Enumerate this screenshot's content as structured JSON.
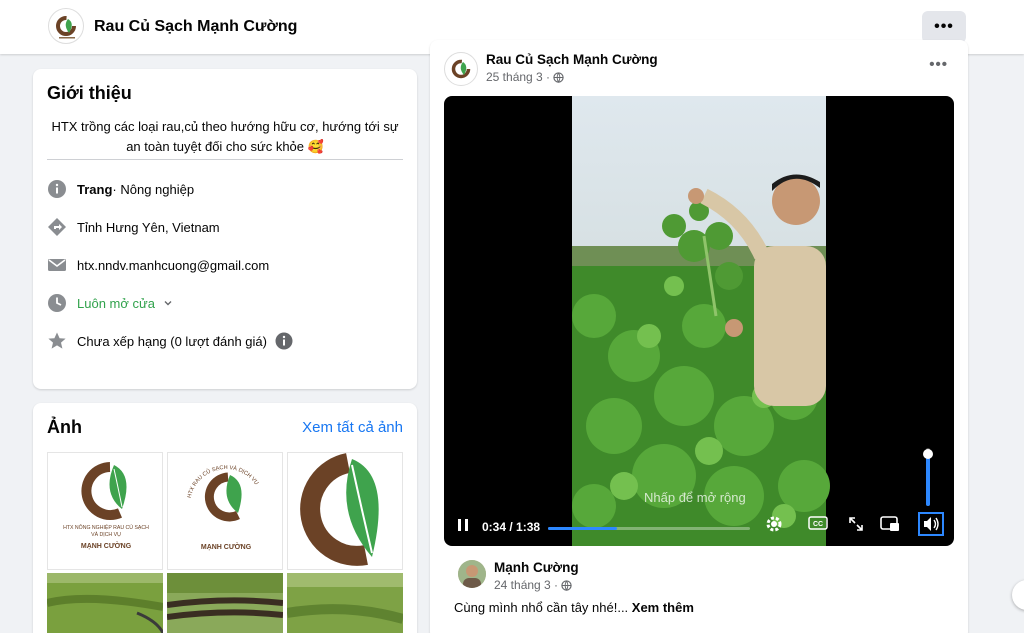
{
  "page": {
    "name": "Rau Củ Sạch Mạnh Cường",
    "more_label": "•••"
  },
  "intro": {
    "heading": "Giới thiệu",
    "bio": "HTX trồng các loại rau,củ theo hướng hữu cơ, hướng tới sự an toàn tuyệt đối cho sức khỏe 🥰",
    "category_label": "Trang",
    "category": " · Nông nghiệp",
    "location": "Tỉnh Hưng Yên, Vietnam",
    "email": "htx.nndv.manhcuong@gmail.com",
    "hours": "Luôn mở cửa",
    "rating": "Chưa xếp hạng (0 lượt đánh giá)"
  },
  "photos": {
    "heading": "Ảnh",
    "see_all": "Xem tất cả ảnh",
    "logo1_line1": "HTX NÔNG NGHIỆP RAU CỦ SẠCH",
    "logo1_line2": "VÀ DỊCH VỤ",
    "logo_brand": "MẠNH CƯỜNG",
    "logo2_arc": "HTX RAU CỦ SẠCH VÀ DỊCH VỤ"
  },
  "post": {
    "author": "Rau Củ Sạch Mạnh Cường",
    "date": "25 tháng 3 · ",
    "more": "•••",
    "video": {
      "hint": "Nhấp để mở rộng",
      "time": "0:34 / 1:38",
      "progress_fraction": 0.34,
      "volume_fraction": 0.9
    },
    "shared": {
      "author": "Mạnh Cường",
      "date": "24 tháng 3 · ",
      "caption": "Cùng mình nhổ cần tây nhé!... ",
      "see_more": "Xem thêm"
    }
  },
  "colors": {
    "accent": "#1877f2",
    "open_green": "#31a24c",
    "brand_brown": "#6b4226",
    "brand_green": "#3fa34d"
  }
}
